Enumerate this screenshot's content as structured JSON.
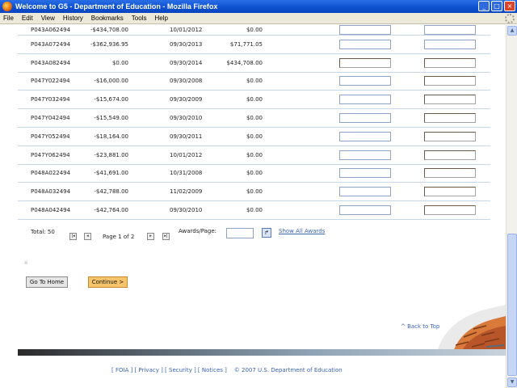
{
  "window": {
    "title": "Welcome to G5 - Department of Education - Mozilla Firefox",
    "controls": [
      "_",
      "□",
      "×"
    ]
  },
  "menu": [
    "File",
    "Edit",
    "View",
    "History",
    "Bookmarks",
    "Tools",
    "Help"
  ],
  "rows": [
    {
      "award": "P043A062494",
      "amount": "-$434,708.00",
      "date": "10/01/2012",
      "balance": "$0.00"
    },
    {
      "award": "P043A072494",
      "amount": "-$362,936.95",
      "date": "09/30/2013",
      "balance": "$71,771.05"
    },
    {
      "award": "P043A082494",
      "amount": "$0.00",
      "date": "09/30/2014",
      "balance": "$434,708.00"
    },
    {
      "award": "P047Y022494",
      "amount": "-$16,000.00",
      "date": "09/30/2008",
      "balance": "$0.00"
    },
    {
      "award": "P047Y032494",
      "amount": "-$15,674.00",
      "date": "09/30/2009",
      "balance": "$0.00"
    },
    {
      "award": "P047Y042494",
      "amount": "-$15,549.00",
      "date": "09/30/2010",
      "balance": "$0.00"
    },
    {
      "award": "P047Y052494",
      "amount": "-$18,164.00",
      "date": "09/30/2011",
      "balance": "$0.00"
    },
    {
      "award": "P047Y062494",
      "amount": "-$23,881.00",
      "date": "10/01/2012",
      "balance": "$0.00"
    },
    {
      "award": "P048A022494",
      "amount": "-$41,691.00",
      "date": "10/31/2008",
      "balance": "$0.00"
    },
    {
      "award": "P048A032494",
      "amount": "-$42,788.00",
      "date": "11/02/2009",
      "balance": "$0.00"
    },
    {
      "award": "P048A042494",
      "amount": "-$42,764.00",
      "date": "09/30/2010",
      "balance": "$0.00"
    }
  ],
  "pager": {
    "total": "Total: 50",
    "page_info": "Page 1 of 2",
    "awards_per_page_label": "Awards/Page:",
    "awards_per_page_value": "",
    "show_all": "Show All Awards",
    "first": "|◂",
    "prev": "◂",
    "next": "▸",
    "last": "▸|",
    "go": "↱"
  },
  "buttons": {
    "home": "Go To Home",
    "continue": "Continue >"
  },
  "back_to_top": "^ Back to Top",
  "footer": {
    "foia": "FOIA",
    "privacy": "Privacy",
    "security": "Security",
    "notices": "Notices",
    "copyright": "© 2007 U.S. Department of Education"
  }
}
